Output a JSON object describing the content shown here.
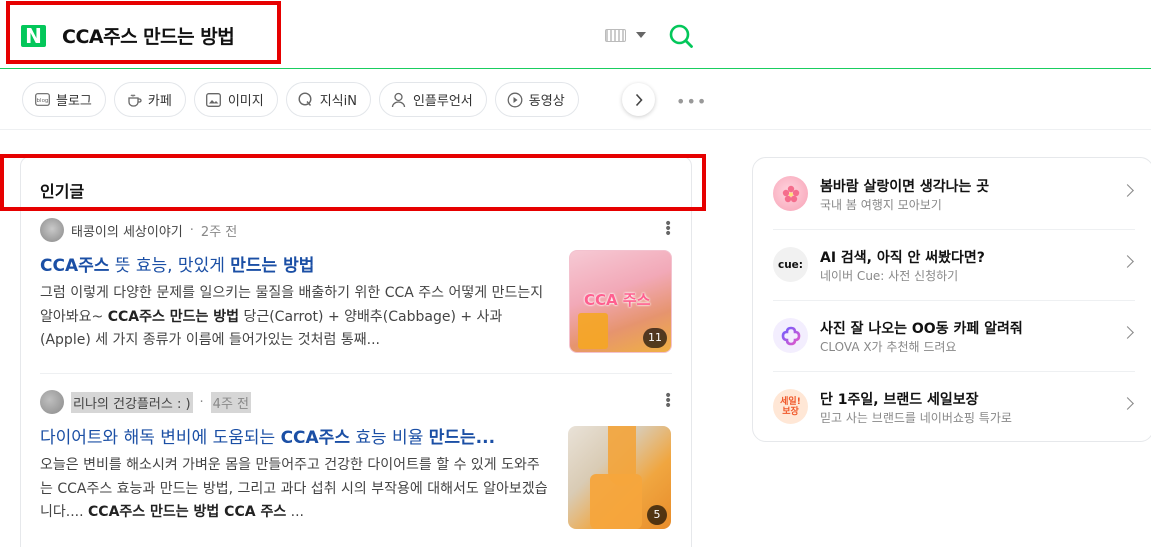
{
  "search": {
    "logo_text": "N",
    "query": "CCA주스 만드는 방법"
  },
  "icons": {
    "logo": "naver-logo-icon",
    "keyboard": "keyboard-icon",
    "search": "search-icon",
    "more": "more-dots-icon"
  },
  "colors": {
    "brand_green": "#03c75a",
    "link_blue": "#1b4fa5",
    "annotation_red": "#e60000"
  },
  "tabs": [
    {
      "label": "블로그",
      "icon": "blog-icon"
    },
    {
      "label": "카페",
      "icon": "cafe-icon"
    },
    {
      "label": "이미지",
      "icon": "image-icon"
    },
    {
      "label": "지식iN",
      "icon": "kin-icon"
    },
    {
      "label": "인플루언서",
      "icon": "person-icon"
    },
    {
      "label": "동영상",
      "icon": "play-icon"
    }
  ],
  "section": {
    "title": "인기글"
  },
  "posts": [
    {
      "author": "태콩이의 세상이야기",
      "time": "2주 전",
      "title_parts": [
        "CCA주스",
        " 뜻 효능, 맛있게 ",
        "만드는 방법",
        ""
      ],
      "desc": "그럼 이렇게 다양한 문제를 일으키는 물질을 배출하기 위한 CCA 주스 어떻게 만드는지 알아봐요~ ",
      "desc_bold": "CCA주스 만드는 방법",
      "desc_tail": " 당근(Carrot) + 양배추(Cabbage) + 사과(Apple) 세 가지 종류가 이름에 들어가있는 것처럼 통째...",
      "thumb_text": "CCA 주스",
      "thumb_count": "11"
    },
    {
      "author": "리나의 건강플러스 : )",
      "time": "4주 전",
      "title_parts": [
        "다이어트와 해독 변비에 도움되는 ",
        "CCA주스",
        " 효능 비율 ",
        "만드는..."
      ],
      "desc": "오늘은 변비를 해소시켜 가벼운 몸을 만들어주고 건강한 다이어트를 할 수 있게 도와주는 CCA주스 효능과 만드는 방법, 그리고 과다 섭취 시의 부작용에 대해서도 알아보겠습니다.... ",
      "desc_bold": "CCA주스 만드는 방법 CCA 주스",
      "desc_tail": " ...",
      "thumb_text": "",
      "thumb_count": "5"
    }
  ],
  "panel": [
    {
      "title": "봄바람 살랑이면 생각나는 곳",
      "sub": "국내 봄 여행지 모아보기",
      "icon": "flower-icon",
      "icon_text": ""
    },
    {
      "title": "AI 검색, 아직 안 써봤다면?",
      "sub": "네이버 Cue: 사전 신청하기",
      "icon": "cue-icon",
      "icon_text": "cue:"
    },
    {
      "title": "사진 잘 나오는 OO동 카페 알려줘",
      "sub": "CLOVA X가 추천해 드려요",
      "icon": "clova-icon",
      "icon_text": ""
    },
    {
      "title": "단 1주일, 브랜드 세일보장",
      "sub": "믿고 사는 브랜드를 네이버쇼핑 특가로",
      "icon": "sale-badge-icon",
      "icon_text": "세일!\n보장"
    }
  ]
}
